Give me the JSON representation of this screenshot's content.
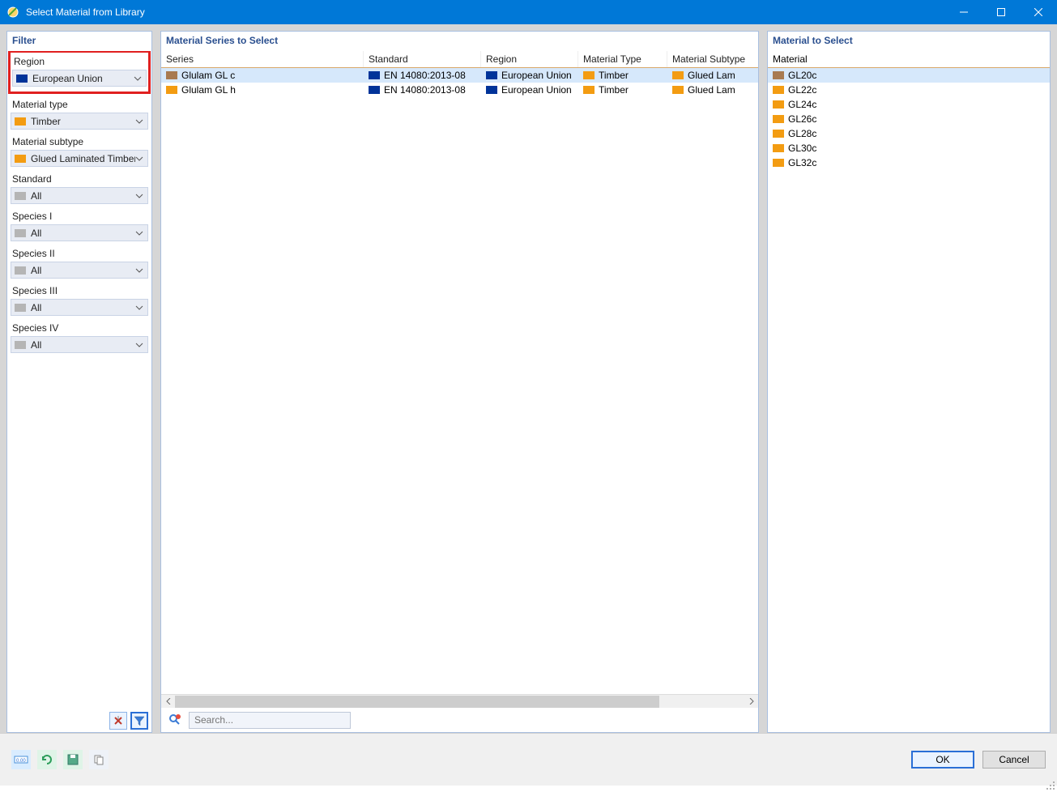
{
  "window": {
    "title": "Select Material from Library"
  },
  "panels": {
    "filter": "Filter",
    "series": "Material Series to Select",
    "material": "Material to Select"
  },
  "filters": {
    "region": {
      "label": "Region",
      "value": "European Union",
      "icon": "eu-flag"
    },
    "material_type": {
      "label": "Material type",
      "value": "Timber",
      "icon": "orange"
    },
    "material_subtype": {
      "label": "Material subtype",
      "value": "Glued Laminated Timber",
      "icon": "orange"
    },
    "standard": {
      "label": "Standard",
      "value": "All",
      "icon": "grey"
    },
    "species1": {
      "label": "Species I",
      "value": "All",
      "icon": "grey"
    },
    "species2": {
      "label": "Species II",
      "value": "All",
      "icon": "grey"
    },
    "species3": {
      "label": "Species III",
      "value": "All",
      "icon": "grey"
    },
    "species4": {
      "label": "Species IV",
      "value": "All",
      "icon": "grey"
    }
  },
  "series_table": {
    "headers": {
      "series": "Series",
      "standard": "Standard",
      "region": "Region",
      "material_type": "Material Type",
      "material_subtype": "Material Subtype"
    },
    "rows": [
      {
        "series": "Glulam GL c",
        "series_icon": "brown",
        "standard": "EN 14080:2013-08",
        "region": "European Union",
        "material_type": "Timber",
        "material_subtype": "Glued Laminated Timber",
        "selected": true
      },
      {
        "series": "Glulam GL h",
        "series_icon": "orange",
        "standard": "EN 14080:2013-08",
        "region": "European Union",
        "material_type": "Timber",
        "material_subtype": "Glued Laminated Timber",
        "selected": false
      }
    ]
  },
  "materials": {
    "header": "Material",
    "items": [
      {
        "name": "GL20c",
        "icon": "brown",
        "selected": true
      },
      {
        "name": "GL22c",
        "icon": "orange",
        "selected": false
      },
      {
        "name": "GL24c",
        "icon": "orange",
        "selected": false
      },
      {
        "name": "GL26c",
        "icon": "orange",
        "selected": false
      },
      {
        "name": "GL28c",
        "icon": "orange",
        "selected": false
      },
      {
        "name": "GL30c",
        "icon": "orange",
        "selected": false
      },
      {
        "name": "GL32c",
        "icon": "orange",
        "selected": false
      }
    ]
  },
  "search": {
    "placeholder": "Search..."
  },
  "buttons": {
    "ok": "OK",
    "cancel": "Cancel"
  },
  "footer_icons": [
    "units-icon",
    "refresh-icon",
    "save-icon",
    "copy-icon"
  ],
  "filter_tools": [
    "clear-filter-icon",
    "funnel-icon"
  ]
}
